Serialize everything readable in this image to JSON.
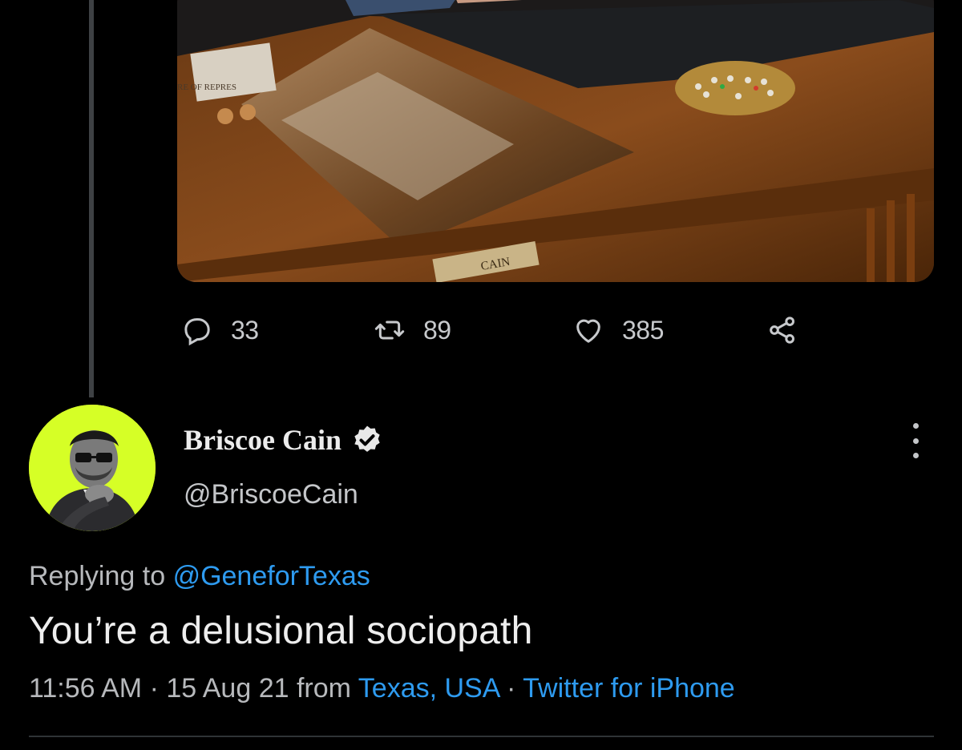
{
  "media": {
    "nameplate_text": "CAIN",
    "frame_text": "RE OF REPRES"
  },
  "actions": {
    "reply": {
      "icon": "reply-icon",
      "count": "33"
    },
    "retweet": {
      "icon": "retweet-icon",
      "count": "89"
    },
    "like": {
      "icon": "heart-icon",
      "count": "385"
    },
    "share": {
      "icon": "share-icon"
    }
  },
  "tweet": {
    "author_name": "Briscoe Cain",
    "author_handle": "@BriscoeCain",
    "replying_prefix": "Replying to",
    "replying_mention": "@GeneforTexas",
    "text": "You’re a delusional sociopath",
    "time": "11:56 AM",
    "sep1": " · ",
    "date": "15 Aug 21",
    "from_word": " from ",
    "location": "Texas, USA",
    "sep2": " · ",
    "source": "Twitter for iPhone"
  },
  "colors": {
    "background": "#000000",
    "link": "#2e9bf0",
    "avatar_bg": "#d6ff26",
    "thread_line": "#3e4144"
  }
}
